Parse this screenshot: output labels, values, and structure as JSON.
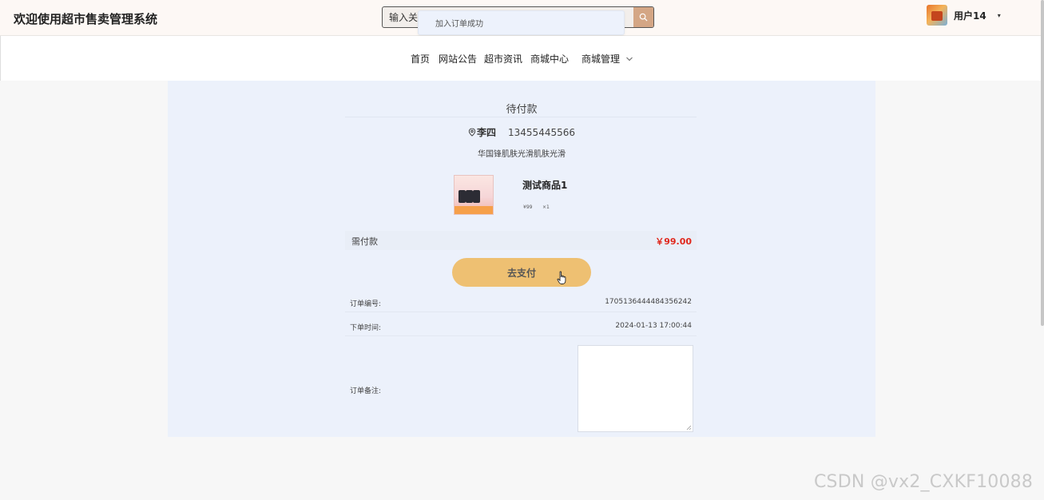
{
  "header": {
    "site_title": "欢迎使用超市售卖管理系统",
    "search_value": "输入关键",
    "user_name": "用户14",
    "user_caret": "▾"
  },
  "toast": {
    "message": "加入订单成功"
  },
  "nav": {
    "items": [
      {
        "label": "首页"
      },
      {
        "label": "网站公告"
      },
      {
        "label": "超市资讯"
      },
      {
        "label": "商城中心"
      },
      {
        "label": "商城管理"
      }
    ]
  },
  "order": {
    "status_title": "待付款",
    "receiver_name": "李四",
    "receiver_phone": "13455445566",
    "address": "华国锋肌肤光滑肌肤光滑",
    "product": {
      "name": "测试商品1",
      "price": "¥99",
      "quantity": "×1"
    },
    "pay_label": "需付款",
    "pay_amount": "￥99.00",
    "pay_button": "去支付",
    "order_no_label": "订单编号:",
    "order_no_value": "1705136444484356242",
    "order_time_label": "下单时间:",
    "order_time_value": "2024-01-13 17:00:44",
    "remark_label": "订单备注:",
    "remark_value": ""
  },
  "watermark": "CSDN @vx2_CXKF10088",
  "colors": {
    "accent": "#eec072",
    "price_red": "#e0281c",
    "search_btn": "#d4a685",
    "panel_bg": "#ecf1fb"
  }
}
